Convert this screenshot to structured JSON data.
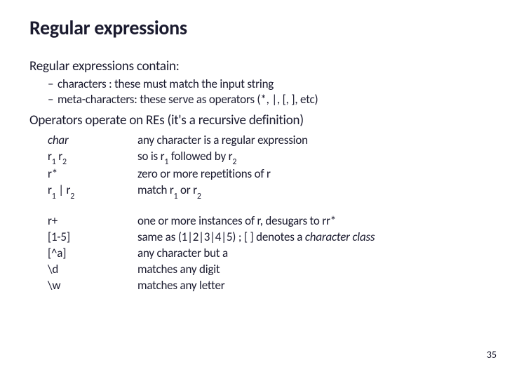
{
  "title": "Regular expressions",
  "line_contain": "Regular expressions contain:",
  "sub1": "characters : these must match the input string",
  "sub2": "meta-characters: these serve as operators (*, |, [, ], etc)",
  "line_ops": "Operators operate on REs (it's a recursive definition)",
  "group1": [
    {
      "left_html": "<span class='italic'>char</span>",
      "right_html": "any character is a regular expression"
    },
    {
      "left_html": "r<span class='sub'>1</span> r<span class='sub'>2</span>",
      "right_html": "so is r<span class='sub'>1</span> followed by r<span class='sub'>2</span>"
    },
    {
      "left_html": "r*",
      "right_html": "zero or more repetitions of r"
    },
    {
      "left_html": "r<span class='sub'>1</span> | r<span class='sub'>2</span>",
      "right_html": "match r<span class='sub'>1</span> or r<span class='sub'>2</span>"
    }
  ],
  "group2": [
    {
      "left_html": "r+",
      "right_html": "one or more instances of r, desugars to rr*"
    },
    {
      "left_html": "[1-5]",
      "right_html": "same as (1|2|3|4|5) ; [ ] denotes a <span class='italic'>character class</span>"
    },
    {
      "left_html": "[^a]",
      "right_html": "any character but a"
    },
    {
      "left_html": "\\d",
      "right_html": "matches any digit"
    },
    {
      "left_html": "\\w",
      "right_html": "matches any letter"
    }
  ],
  "page_number": "35"
}
